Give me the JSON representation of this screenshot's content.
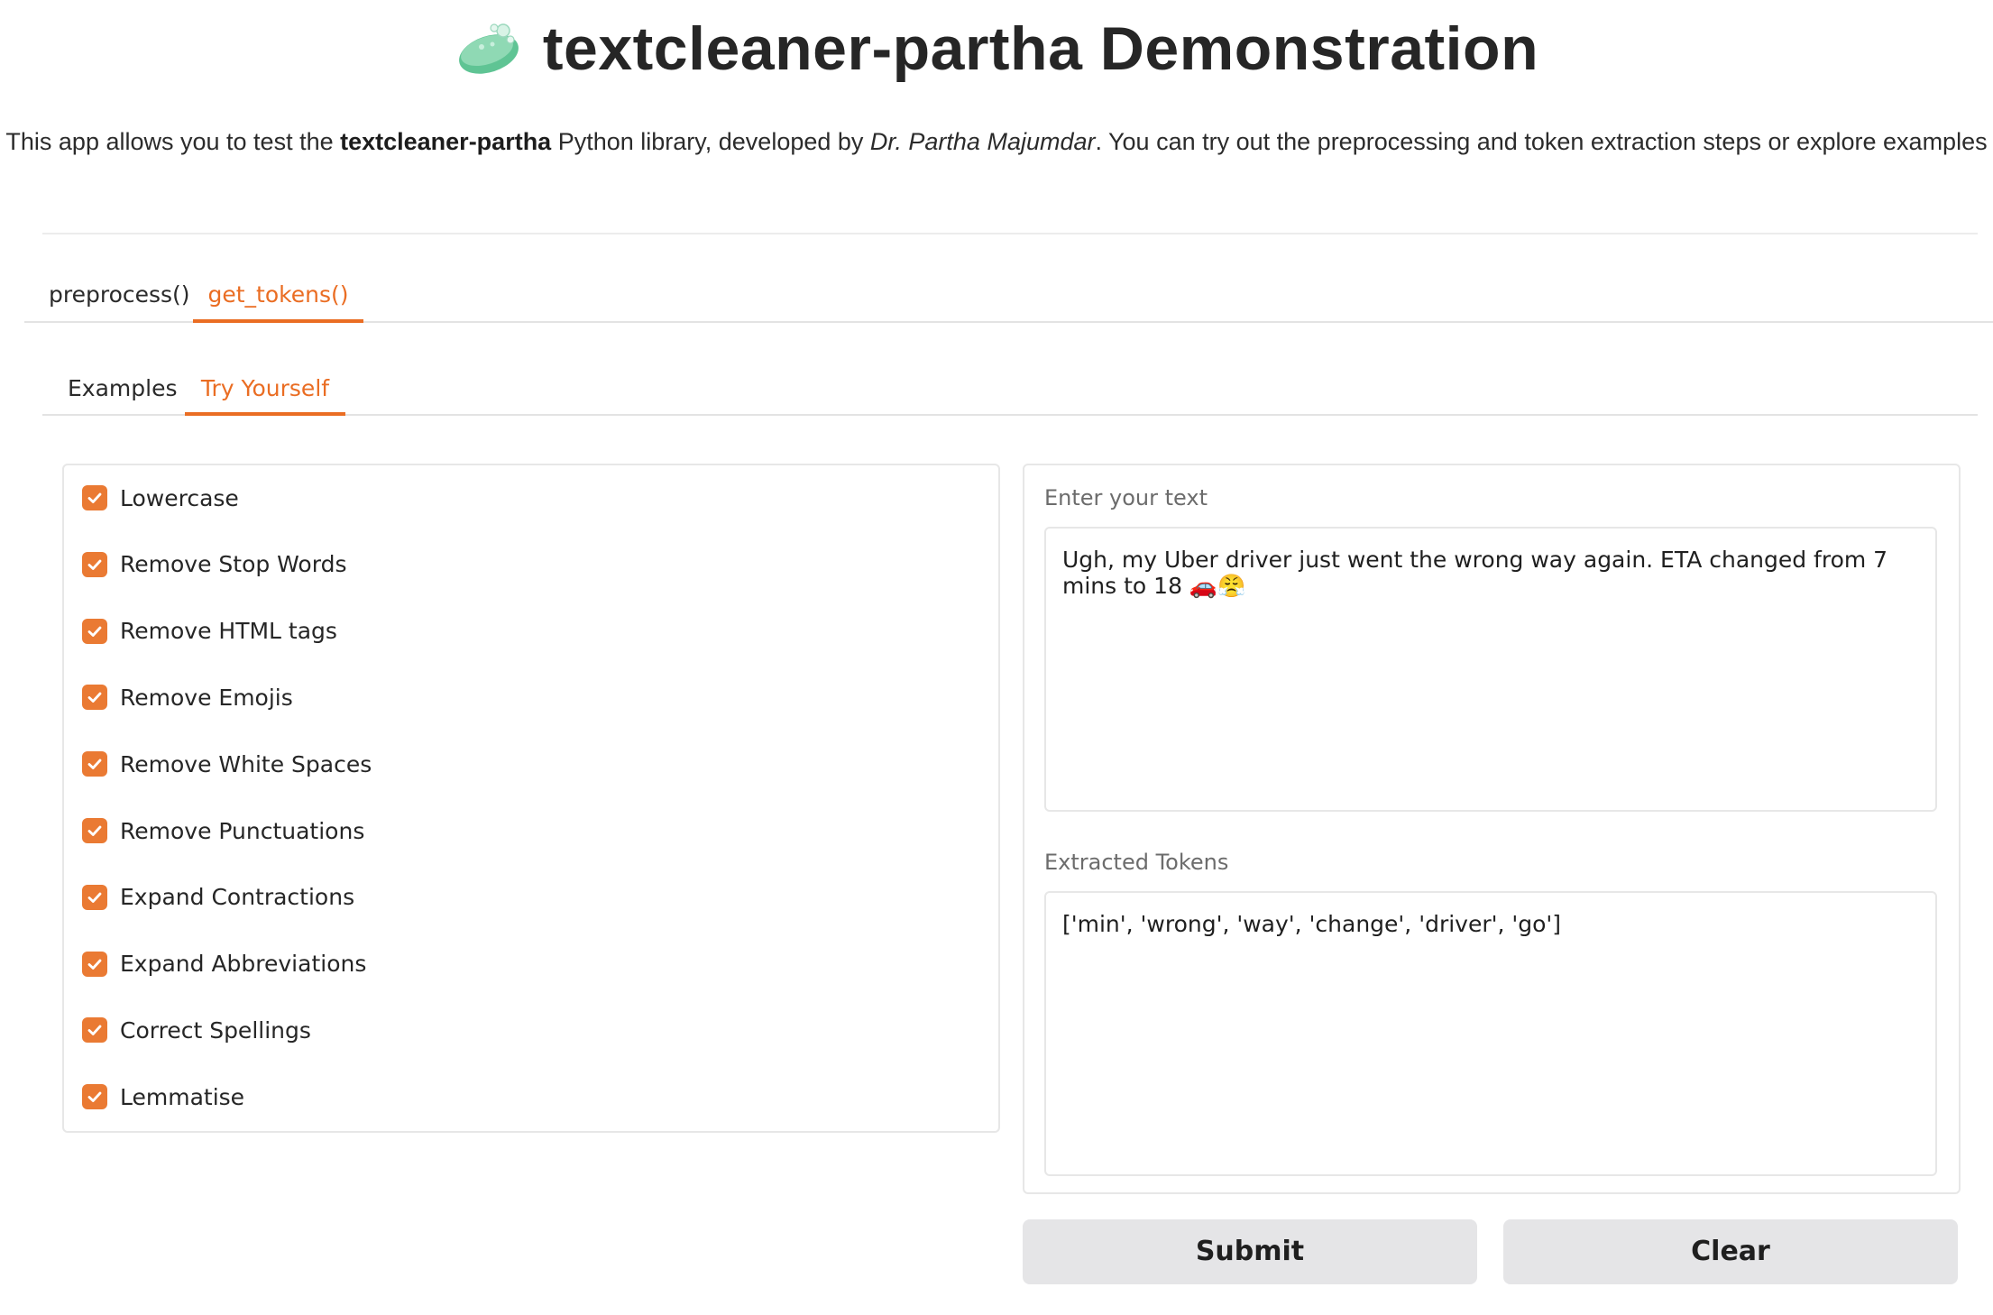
{
  "header": {
    "title": "textcleaner-partha Demonstration",
    "logo_icon": "soap-bar-icon",
    "desc_prefix": "This app allows you to test the ",
    "desc_lib": "textcleaner-partha",
    "desc_mid": " Python library, developed by ",
    "desc_author": "Dr. Partha Majumdar",
    "desc_suffix": ". You can try out the preprocessing and token extraction steps or explore examples"
  },
  "main_tabs": [
    {
      "label": "preprocess()",
      "active": false
    },
    {
      "label": "get_tokens()",
      "active": true
    }
  ],
  "sub_tabs": [
    {
      "label": "Examples",
      "active": false
    },
    {
      "label": "Try Yourself",
      "active": true
    }
  ],
  "options": [
    {
      "label": "Lowercase",
      "checked": true
    },
    {
      "label": "Remove Stop Words",
      "checked": true
    },
    {
      "label": "Remove HTML tags",
      "checked": true
    },
    {
      "label": "Remove Emojis",
      "checked": true
    },
    {
      "label": "Remove White Spaces",
      "checked": true
    },
    {
      "label": "Remove Punctuations",
      "checked": true
    },
    {
      "label": "Expand Contractions",
      "checked": true
    },
    {
      "label": "Expand Abbreviations",
      "checked": true
    },
    {
      "label": "Correct Spellings",
      "checked": true
    },
    {
      "label": "Lemmatise",
      "checked": true
    }
  ],
  "input": {
    "label": "Enter your text",
    "value": "Ugh, my Uber driver just went the wrong way again. ETA changed from 7 mins to 18 🚗😤"
  },
  "output": {
    "label": "Extracted Tokens",
    "value": "['min', 'wrong', 'way', 'change', 'driver', 'go']"
  },
  "buttons": {
    "submit": "Submit",
    "clear": "Clear"
  },
  "colors": {
    "accent": "#ea6d23",
    "checkbox": "#ea7a33",
    "button_bg": "#e5e5e7"
  }
}
